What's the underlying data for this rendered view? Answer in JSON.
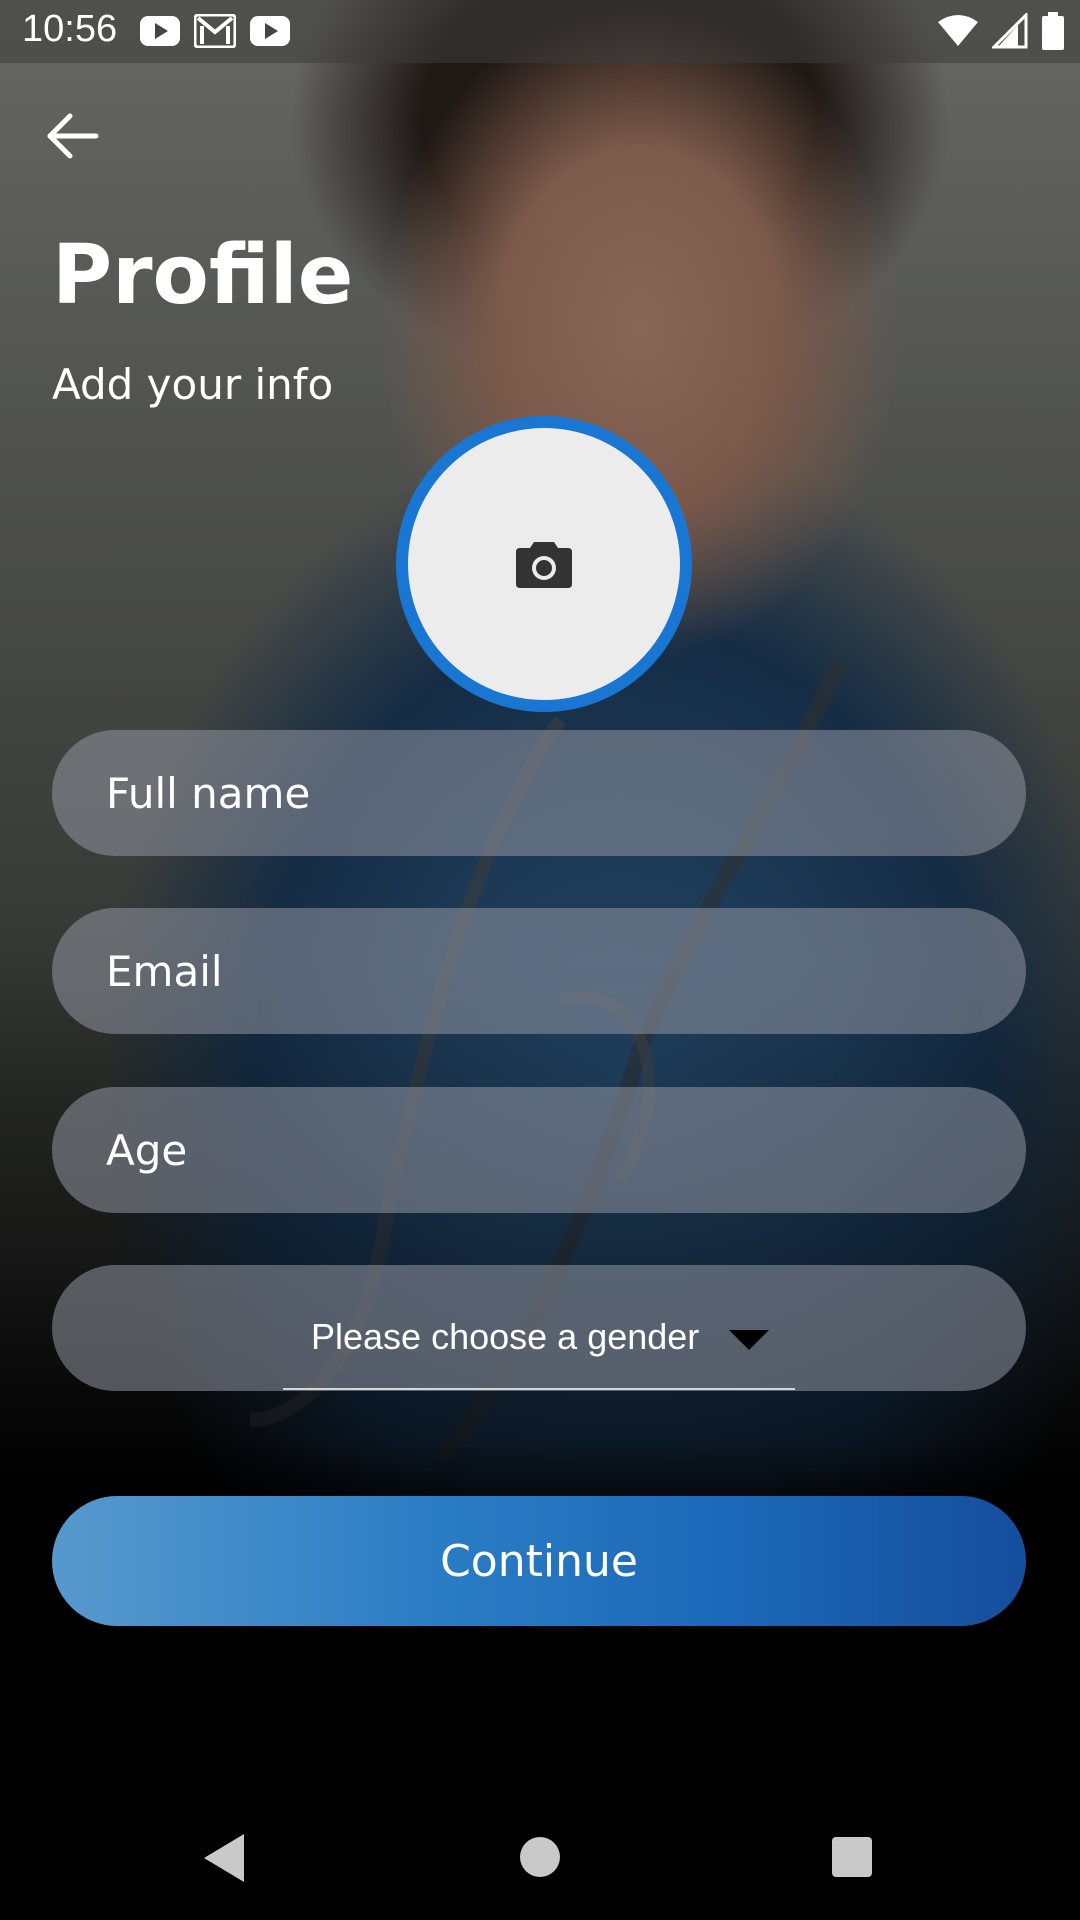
{
  "status_bar": {
    "time": "10:56",
    "left_icons": [
      "youtube-icon",
      "gmail-icon",
      "youtube-icon"
    ],
    "right_icons": [
      "wifi-icon",
      "signal-icon",
      "battery-icon"
    ]
  },
  "header": {
    "back_icon": "arrow-back-icon",
    "title": "Profile",
    "subtitle": "Add your info"
  },
  "avatar": {
    "icon": "camera-icon",
    "border_color": "#1976d2"
  },
  "form": {
    "full_name_placeholder": "Full name",
    "email_placeholder": "Email",
    "age_placeholder": "Age",
    "gender_selected": "Please choose a gender"
  },
  "continue_label": "Continue",
  "nav": {
    "back_icon": "nav-back-icon",
    "home_icon": "nav-home-icon",
    "recents_icon": "nav-recents-icon"
  }
}
